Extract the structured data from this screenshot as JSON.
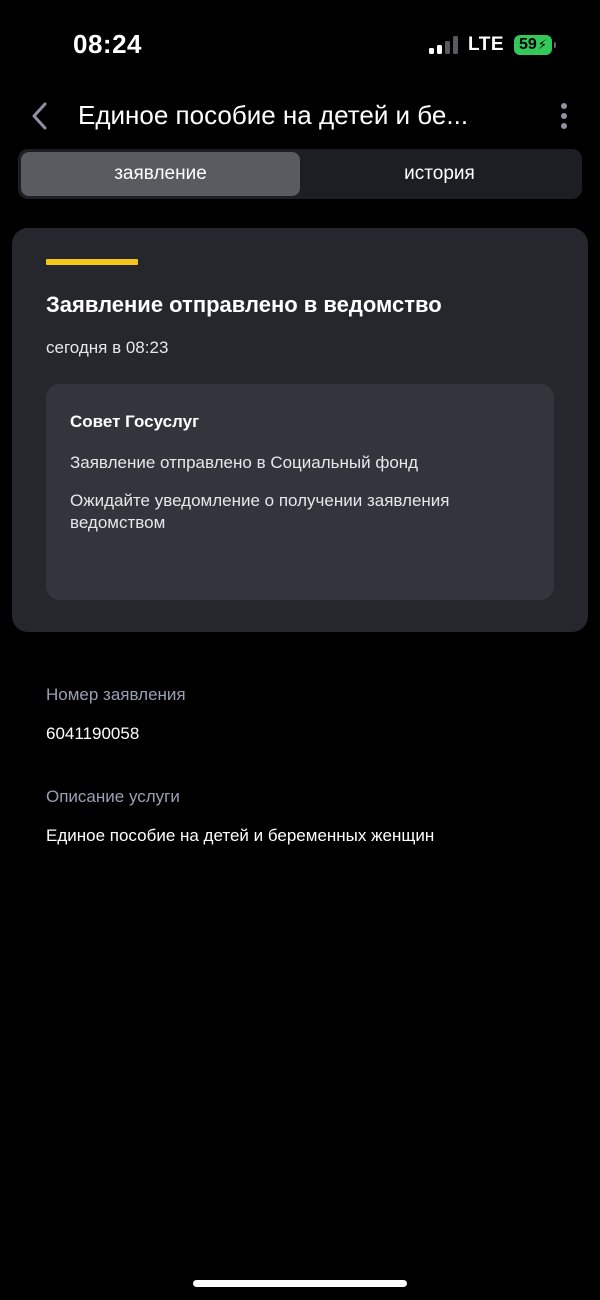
{
  "status_bar": {
    "time": "08:24",
    "network": "LTE",
    "battery": "59",
    "signal_bars": [
      {
        "level": 1,
        "active": true
      },
      {
        "level": 2,
        "active": true
      },
      {
        "level": 3,
        "active": false
      },
      {
        "level": 4,
        "active": false
      }
    ]
  },
  "header": {
    "title": "Единое пособие на детей и бе..."
  },
  "tabs": [
    {
      "label": "заявление",
      "active": true
    },
    {
      "label": "история",
      "active": false
    }
  ],
  "status_card": {
    "accent_color": "#f5c518",
    "title": "Заявление отправлено в ведомство",
    "date": "сегодня в 08:23",
    "message": {
      "sender": "Совет Госуслуг",
      "line1": "Заявление отправлено в Социальный фонд",
      "line2": "Ожидайте уведомление о получении заявления ведомством"
    }
  },
  "details": {
    "number_label": "Номер заявления",
    "number_value": "6041190058",
    "description_label": "Описание услуги",
    "description_value": "Единое пособие на детей и беременных женщин"
  },
  "colors": {
    "background": "#000000",
    "card": "#26272d",
    "message_box": "#34353c",
    "label": "#9a9fb5",
    "battery": "#34c759"
  }
}
